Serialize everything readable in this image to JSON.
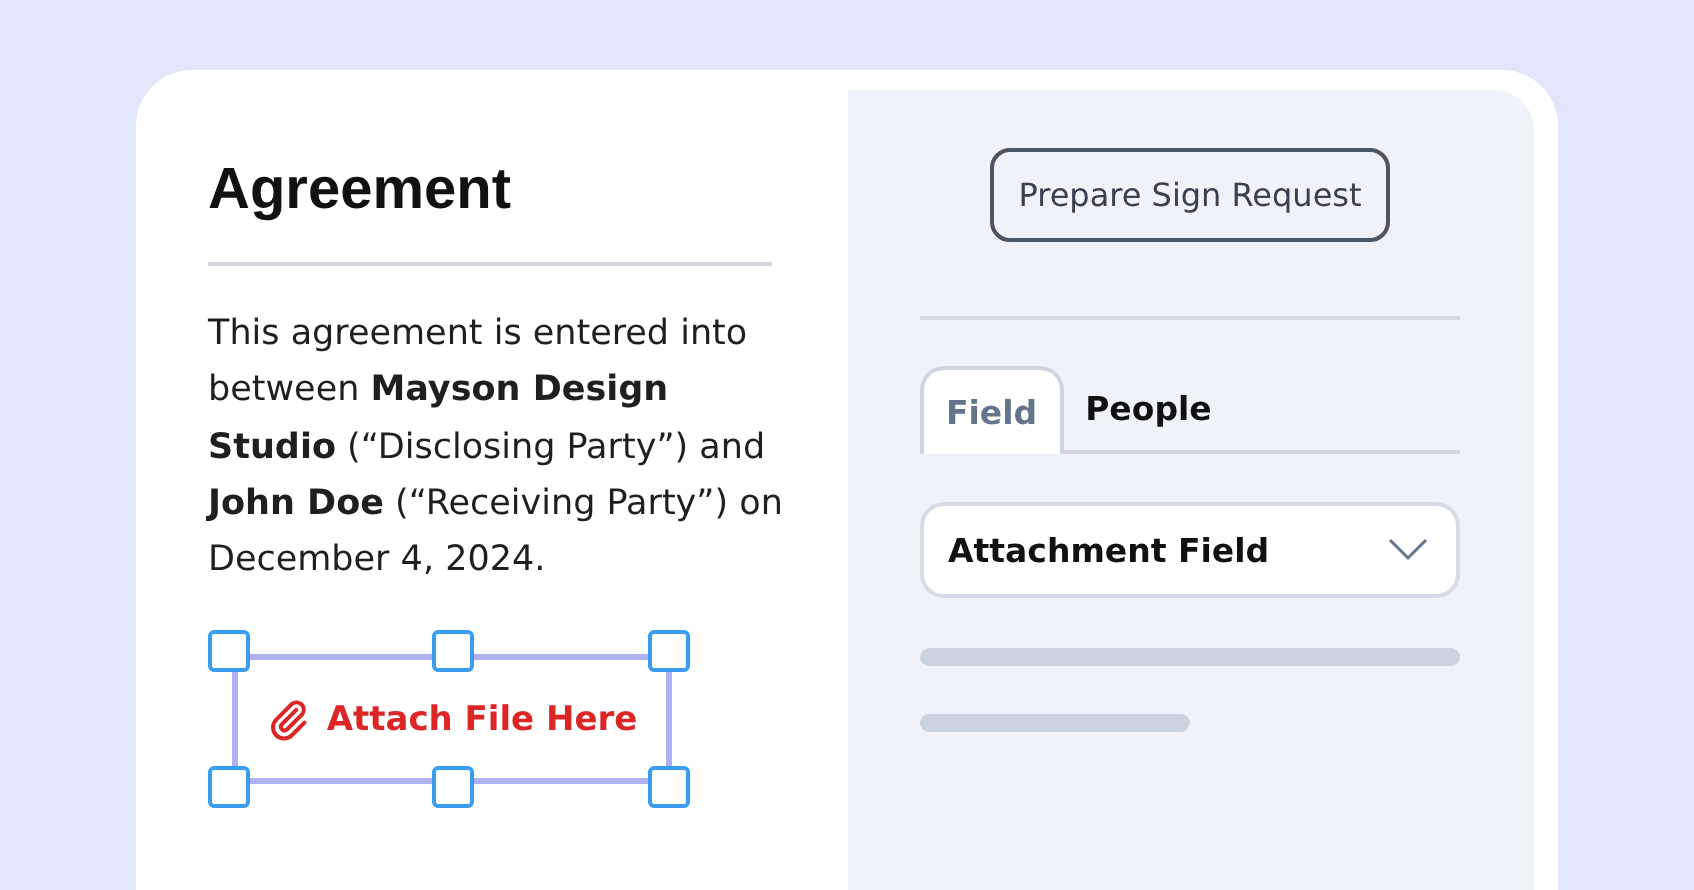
{
  "document": {
    "title": "Agreement",
    "body": "This agreement is entered into between **Mayson Design Studio** (“Disclosing Party”) and **John Doe** (“Receiving Party”) on December 4, 2024.",
    "attachment_field": {
      "label": "Attach File Here",
      "selected": true
    }
  },
  "panel": {
    "button": "Prepare Sign Request",
    "tabs": [
      {
        "label": "Field",
        "selected": true
      },
      {
        "label": "People",
        "selected": false
      }
    ],
    "dropdown": {
      "value": "Attachment Field"
    }
  }
}
